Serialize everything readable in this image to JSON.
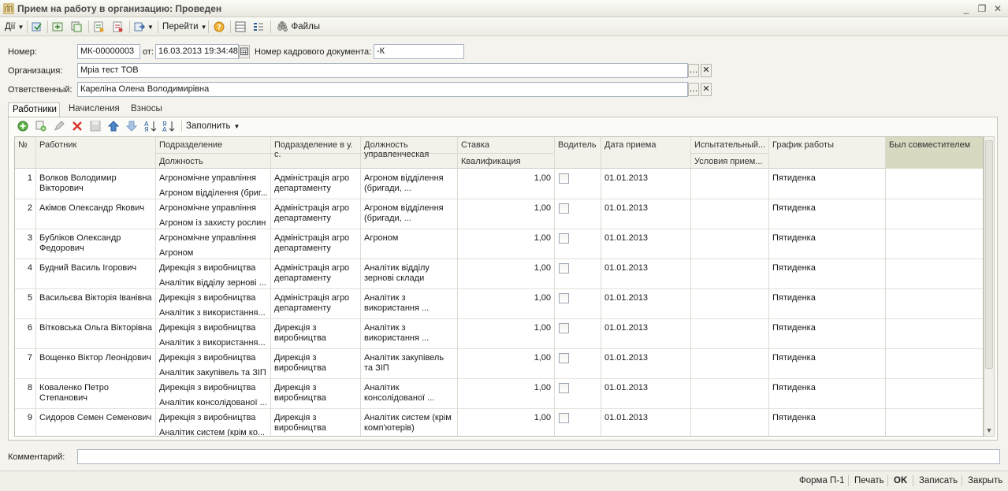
{
  "window": {
    "title": "Прием на работу в организацию: Проведен",
    "controls": [
      "_",
      "❐",
      "✕"
    ]
  },
  "toolbar": {
    "actions_label": "Дії",
    "goto_label": "Перейти",
    "files_label": "Файлы"
  },
  "form": {
    "number_label": "Номер:",
    "number_value": "МК-00000003",
    "from_label": "от:",
    "date_value": "16.03.2013 19:34:48",
    "hr_doc_label": "Номер кадрового документа:",
    "hr_doc_value": "-К",
    "org_label": "Организация:",
    "org_value": "Мріа тест ТОВ",
    "responsible_label": "Ответственный:",
    "responsible_value": "Кареліна Олена Володимирівна",
    "comment_label": "Комментарий:",
    "comment_value": ""
  },
  "tabs": [
    "Работники",
    "Начисления",
    "Взносы"
  ],
  "inner_toolbar": {
    "fill_label": "Заполнить"
  },
  "table": {
    "headers": {
      "num": "№",
      "employee": "Работник",
      "division": "Подразделение",
      "position": "Должность",
      "division_acc": "Подразделение в у. с.",
      "position_mgmt": "Должность управленческая",
      "rate": "Ставка",
      "qualification": "Квалификация",
      "driver": "Водитель",
      "hire_date": "Дата приема",
      "probation": "Испытательный...",
      "hire_conditions": "Условия прием...",
      "schedule": "График работы",
      "was_parttime": "Был совместителем"
    },
    "rows": [
      {
        "num": "1",
        "employee": "Волков Володимир Вікторович",
        "division": "Агрономічне управління",
        "position": "Агроном відділення (бриг...",
        "division_acc": "Адміністрація агро департаменту",
        "position_mgmt": "Агроном відділення (бригади, ...",
        "rate": "1,00",
        "hire_date": "01.01.2013",
        "schedule": "Пятиденка"
      },
      {
        "num": "2",
        "employee": "Акімов Олександр Якович",
        "division": "Агрономічне управління",
        "position": "Агроном із захисту рослин",
        "division_acc": "Адміністрація агро департаменту",
        "position_mgmt": "Агроном відділення (бригади, ...",
        "rate": "1,00",
        "hire_date": "01.01.2013",
        "schedule": "Пятиденка"
      },
      {
        "num": "3",
        "employee": "Бубліков Олександр Федорович",
        "division": "Агрономічне управління",
        "position": "Агроном",
        "division_acc": "Адміністрація агро департаменту",
        "position_mgmt": "Агроном",
        "rate": "1,00",
        "hire_date": "01.01.2013",
        "schedule": "Пятиденка"
      },
      {
        "num": "4",
        "employee": "Будний Василь Ігорович",
        "division": "Дирекція з виробництва",
        "position": "Аналітик відділу зернові ...",
        "division_acc": "Адміністрація агро департаменту",
        "position_mgmt": "Аналітик відділу зернові склади",
        "rate": "1,00",
        "hire_date": "01.01.2013",
        "schedule": "Пятиденка"
      },
      {
        "num": "5",
        "employee": "Васильєва Вікторія Іванівна",
        "division": "Дирекція з виробництва",
        "position": "Аналітик з використання...",
        "division_acc": "Адміністрація агро департаменту",
        "position_mgmt": "Аналітик з використання ...",
        "rate": "1,00",
        "hire_date": "01.01.2013",
        "schedule": "Пятиденка"
      },
      {
        "num": "6",
        "employee": "Вітковська Ольга Вікторівна",
        "division": "Дирекція з виробництва",
        "position": "Аналітик з використання...",
        "division_acc": "Дирекція з виробництва",
        "position_mgmt": "Аналітик з використання ...",
        "rate": "1,00",
        "hire_date": "01.01.2013",
        "schedule": "Пятиденка"
      },
      {
        "num": "7",
        "employee": "Вощенко Віктор Леонідович",
        "division": "Дирекція з виробництва",
        "position": "Аналітик закупівель та ЗІП",
        "division_acc": "Дирекція з виробництва",
        "position_mgmt": "Аналітик закупівель та ЗІП",
        "rate": "1,00",
        "hire_date": "01.01.2013",
        "schedule": "Пятиденка"
      },
      {
        "num": "8",
        "employee": "Коваленко Петро Степанович",
        "division": "Дирекція з виробництва",
        "position": "Аналітик консолідованої ...",
        "division_acc": "Дирекція з виробництва",
        "position_mgmt": "Аналітик консолідованої ...",
        "rate": "1,00",
        "hire_date": "01.01.2013",
        "schedule": "Пятиденка"
      },
      {
        "num": "9",
        "employee": "Сидоров Семен Семенович",
        "division": "Дирекція з виробництва",
        "position": "Аналітик систем (крім ко...",
        "division_acc": "Дирекція з виробництва",
        "position_mgmt": "Аналітик систем (крім комп'ютерів)",
        "rate": "1,00",
        "hire_date": "01.01.2013",
        "schedule": "Пятиденка"
      }
    ]
  },
  "footer": {
    "form_p1": "Форма П-1",
    "print": "Печать",
    "ok": "OK",
    "save": "Записать",
    "close": "Закрыть"
  }
}
